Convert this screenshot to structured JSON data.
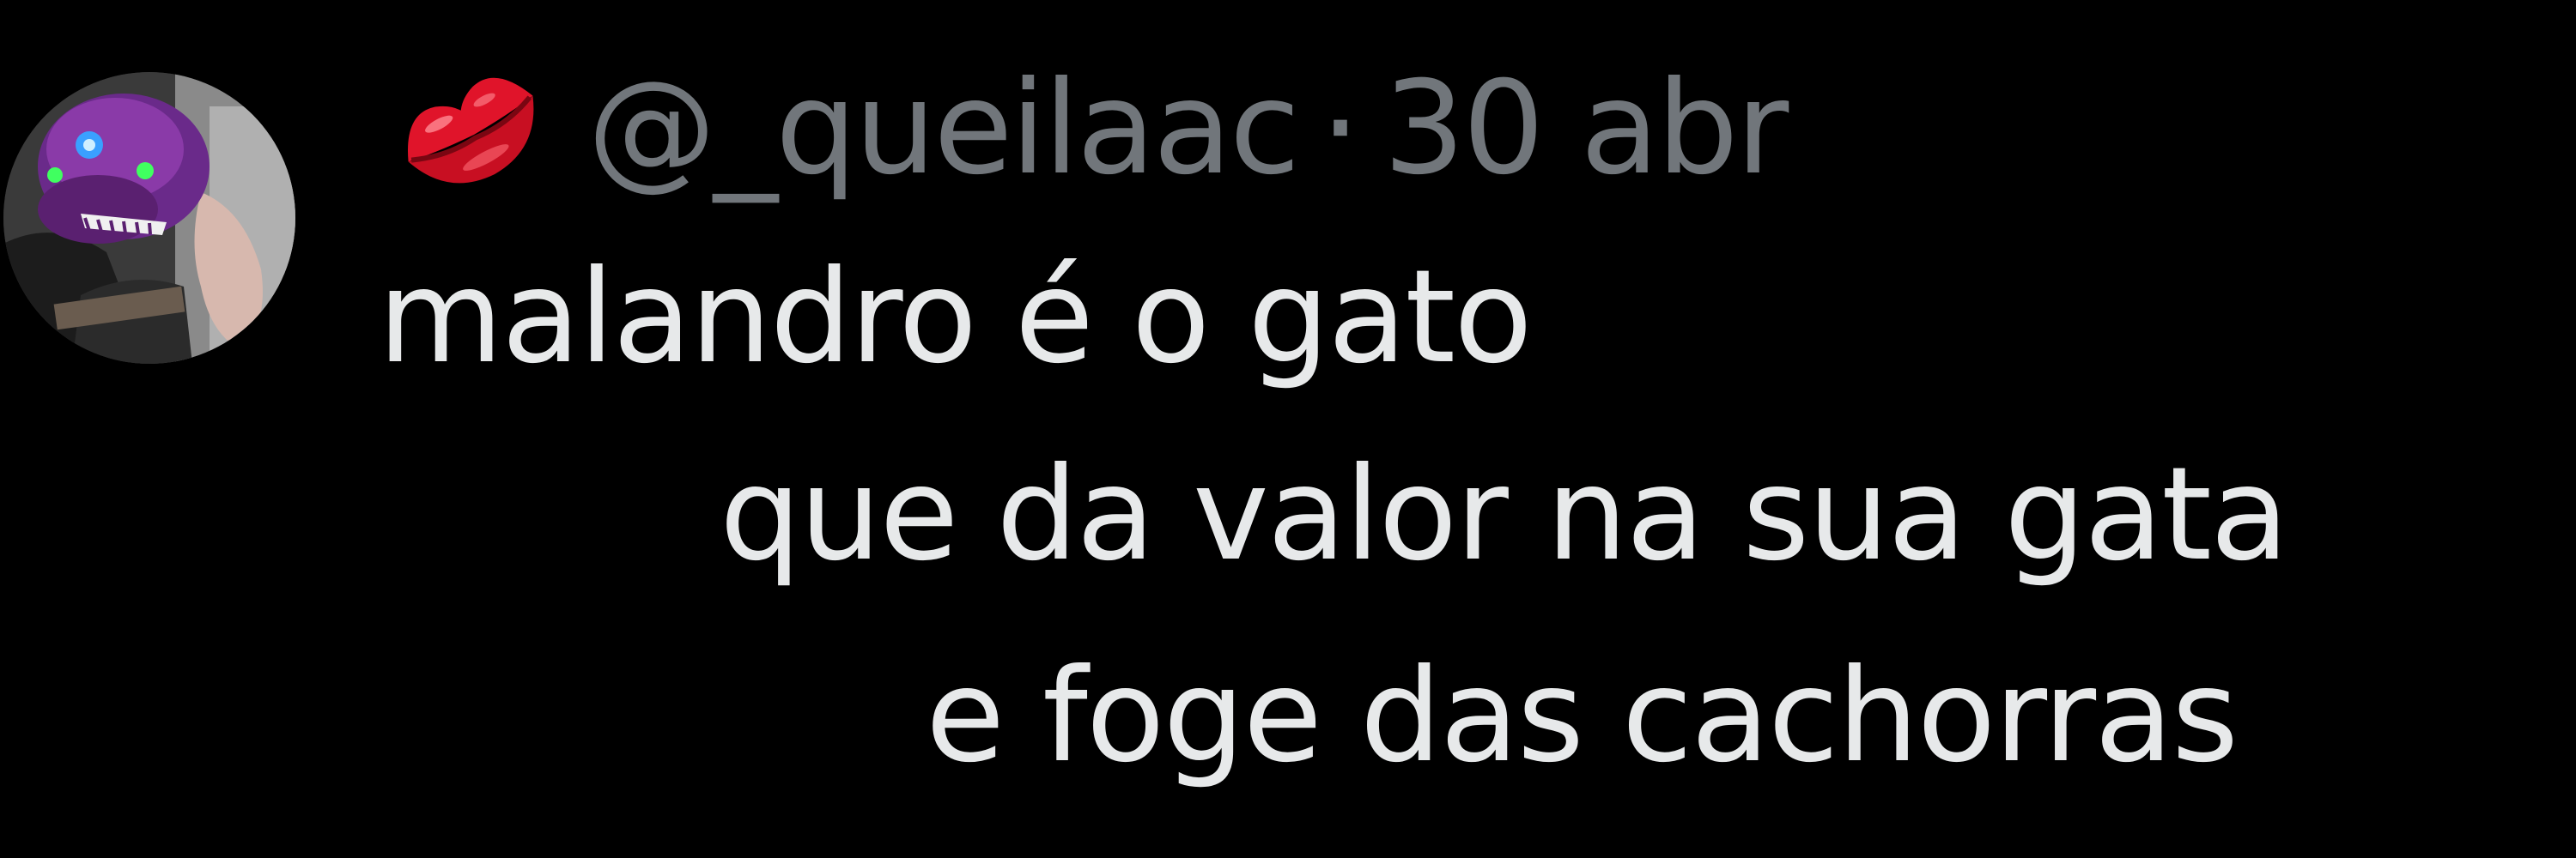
{
  "tweet": {
    "author": {
      "emoji_icon": "kiss-mark-icon",
      "handle": "@_queilaac"
    },
    "separator": "·",
    "date": "30 abr",
    "text_lines": [
      "malandro é o gato",
      "que da valor na sua gata",
      "e foge das cachorras"
    ]
  },
  "colors": {
    "background": "#000000",
    "secondary_text": "#71767b",
    "primary_text": "#e7e9ea",
    "lips": "#e0142a"
  }
}
